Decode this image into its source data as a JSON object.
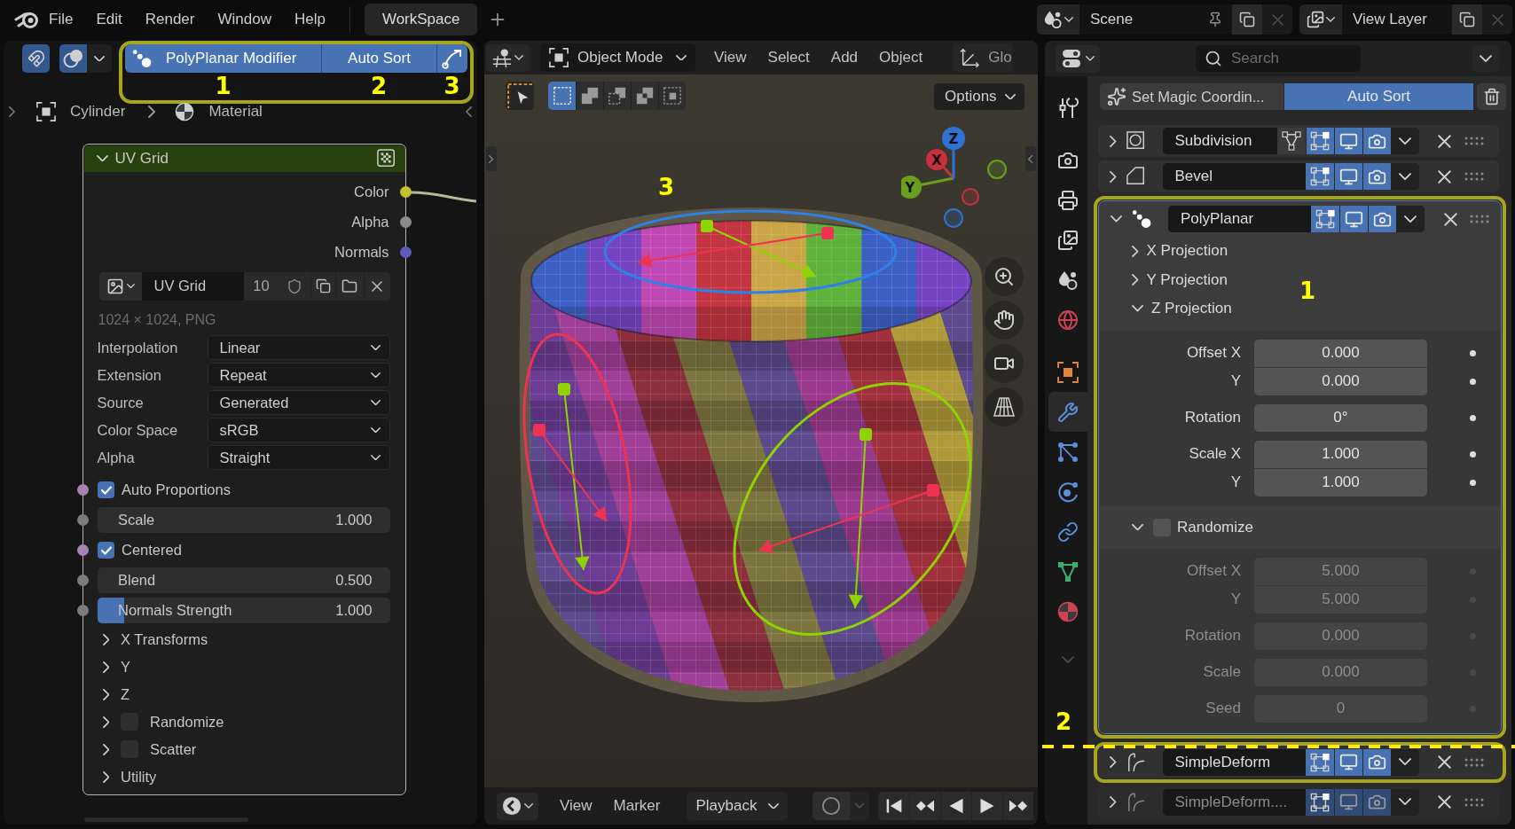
{
  "top_bar": {
    "menus": [
      "File",
      "Edit",
      "Render",
      "Window",
      "Help"
    ],
    "workspace_tabs": [
      {
        "label": "WorkSpace",
        "selected": true
      }
    ],
    "scene": "Scene",
    "view_layer": "View Layer"
  },
  "node_editor": {
    "snapping": true,
    "overlays": true,
    "toolbar": {
      "modifier_button": "PolyPlanar Modifier",
      "sort_button": "Auto Sort"
    },
    "annotation_numbers": [
      "1",
      "2",
      "3"
    ],
    "breadcrumb": [
      "Cylinder",
      "Material"
    ],
    "node": {
      "title": "UV Grid",
      "expanded": true,
      "outputs": [
        {
          "name": "Color",
          "color": "#c2c22e",
          "linked": true
        },
        {
          "name": "Alpha",
          "color": "#8a8a8a",
          "linked": false
        },
        {
          "name": "Normals",
          "color": "#5c5cb8",
          "linked": false
        }
      ],
      "image": {
        "name": "UV Grid",
        "users": "10"
      },
      "image_info": "1024 × 1024, PNG",
      "settings": [
        {
          "label": "Interpolation",
          "value": "Linear"
        },
        {
          "label": "Extension",
          "value": "Repeat"
        },
        {
          "label": "Source",
          "value": "Generated"
        },
        {
          "label": "Color Space",
          "value": "sRGB"
        },
        {
          "label": "Alpha",
          "value": "Straight"
        }
      ],
      "inputs": [
        {
          "kind": "checkbox",
          "label": "Auto Proportions",
          "checked": true,
          "color": "#a584b5"
        },
        {
          "kind": "number",
          "label": "Scale",
          "value": "1.000",
          "color": "#7c7c7c"
        },
        {
          "kind": "checkbox",
          "label": "Centered",
          "checked": true,
          "color": "#a584b5"
        },
        {
          "kind": "number",
          "label": "Blend",
          "value": "0.500",
          "color": "#7c7c7c"
        },
        {
          "kind": "slider",
          "label": "Normals Strength",
          "value": "1.000",
          "level": 0.09,
          "color": "#7c7c7c"
        }
      ],
      "panels": [
        {
          "kind": "plain",
          "label": "X Transforms",
          "expanded": false
        },
        {
          "kind": "plain",
          "label": "Y",
          "expanded": false
        },
        {
          "kind": "plain",
          "label": "Z",
          "expanded": false
        },
        {
          "kind": "checkbox",
          "label": "Randomize",
          "expanded": false,
          "checked": false
        },
        {
          "kind": "checkbox",
          "label": "Scatter",
          "expanded": false,
          "checked": false
        },
        {
          "kind": "plain",
          "label": "Utility",
          "expanded": false
        }
      ]
    }
  },
  "viewport": {
    "mode": "Object Mode",
    "menus": [
      "View",
      "Select",
      "Add",
      "Object"
    ],
    "orientation": "Glo",
    "select_modes": [
      {
        "kind": "set",
        "selected": true
      },
      {
        "kind": "extend",
        "selected": false
      },
      {
        "kind": "subtract",
        "selected": false
      },
      {
        "kind": "difference",
        "selected": false
      },
      {
        "kind": "intersect",
        "selected": false
      }
    ],
    "options": "Options",
    "annotation_number": "3",
    "gizmo_axes": [
      {
        "label": "Y",
        "color": "#6a9f1e"
      },
      {
        "label": "X",
        "color": "#c8303f"
      },
      {
        "label": "Z",
        "color": "#2e72d2"
      }
    ],
    "timeline": {
      "menus": [
        "View",
        "Marker"
      ],
      "playback": "Playback",
      "auto_keying": false
    }
  },
  "properties": {
    "search": {
      "placeholder": "Search"
    },
    "tab_groups": [
      [
        {
          "kind": "tool",
          "selected": false
        }
      ],
      [
        {
          "kind": "render",
          "selected": false
        },
        {
          "kind": "output",
          "selected": false
        },
        {
          "kind": "view_layer",
          "selected": false
        },
        {
          "kind": "scene",
          "selected": false
        },
        {
          "kind": "world",
          "selected": false
        }
      ],
      [
        {
          "kind": "object",
          "selected": false
        },
        {
          "kind": "modifier",
          "selected": true
        },
        {
          "kind": "particles",
          "selected": false
        },
        {
          "kind": "physics",
          "selected": false
        },
        {
          "kind": "constraints",
          "selected": false
        },
        {
          "kind": "data",
          "selected": false
        },
        {
          "kind": "material",
          "selected": false
        }
      ]
    ],
    "toolbar": {
      "magic_button": "Set Magic Coordin...",
      "sort_button": "Auto Sort"
    },
    "annotation_numbers": [
      "1",
      "2"
    ],
    "modifiers": [
      {
        "name": "Subdivision",
        "kind": "subdivision",
        "expanded": false,
        "highlighted": false,
        "dimmed": false,
        "on_cage": false,
        "edit_mode": true,
        "viewport": true,
        "render": true
      },
      {
        "name": "Bevel",
        "kind": "bevel",
        "expanded": false,
        "highlighted": false,
        "dimmed": false,
        "edit_mode": true,
        "viewport": true,
        "render": true
      },
      {
        "name": "PolyPlanar",
        "kind": "polyplanar",
        "expanded": true,
        "highlighted": true,
        "dimmed": false,
        "edit_mode": true,
        "viewport": true,
        "render": true,
        "settings": {
          "projections": [
            {
              "label": "X Projection",
              "expanded": false
            },
            {
              "label": "Y Projection",
              "expanded": false
            },
            {
              "label": "Z Projection",
              "expanded": true,
              "field_groups": [
                [
                  {
                    "label": "Offset X",
                    "value": "0.000"
                  },
                  {
                    "label": "Y",
                    "value": "0.000"
                  }
                ],
                [
                  {
                    "label": "Rotation",
                    "value": "0°"
                  }
                ],
                [
                  {
                    "label": "Scale X",
                    "value": "1.000"
                  },
                  {
                    "label": "Y",
                    "value": "1.000"
                  }
                ]
              ]
            }
          ],
          "randomize": {
            "label": "Randomize",
            "expanded": true,
            "checked": false,
            "field_groups": [
              [
                {
                  "label": "Offset X",
                  "value": "5.000"
                },
                {
                  "label": "Y",
                  "value": "5.000"
                }
              ],
              [
                {
                  "label": "Rotation",
                  "value": "0.000"
                }
              ],
              [
                {
                  "label": "Scale",
                  "value": "0.000"
                }
              ],
              [
                {
                  "label": "Seed",
                  "value": "0"
                }
              ]
            ]
          }
        }
      },
      {
        "name": "SimpleDeform",
        "kind": "simple_deform",
        "expanded": false,
        "highlighted": true,
        "dimmed": false,
        "edit_mode": true,
        "viewport": true,
        "render": true
      },
      {
        "name": "SimpleDeform....",
        "kind": "simple_deform",
        "expanded": false,
        "highlighted": false,
        "dimmed": true,
        "edit_mode": true,
        "viewport": true,
        "render": true
      }
    ]
  }
}
